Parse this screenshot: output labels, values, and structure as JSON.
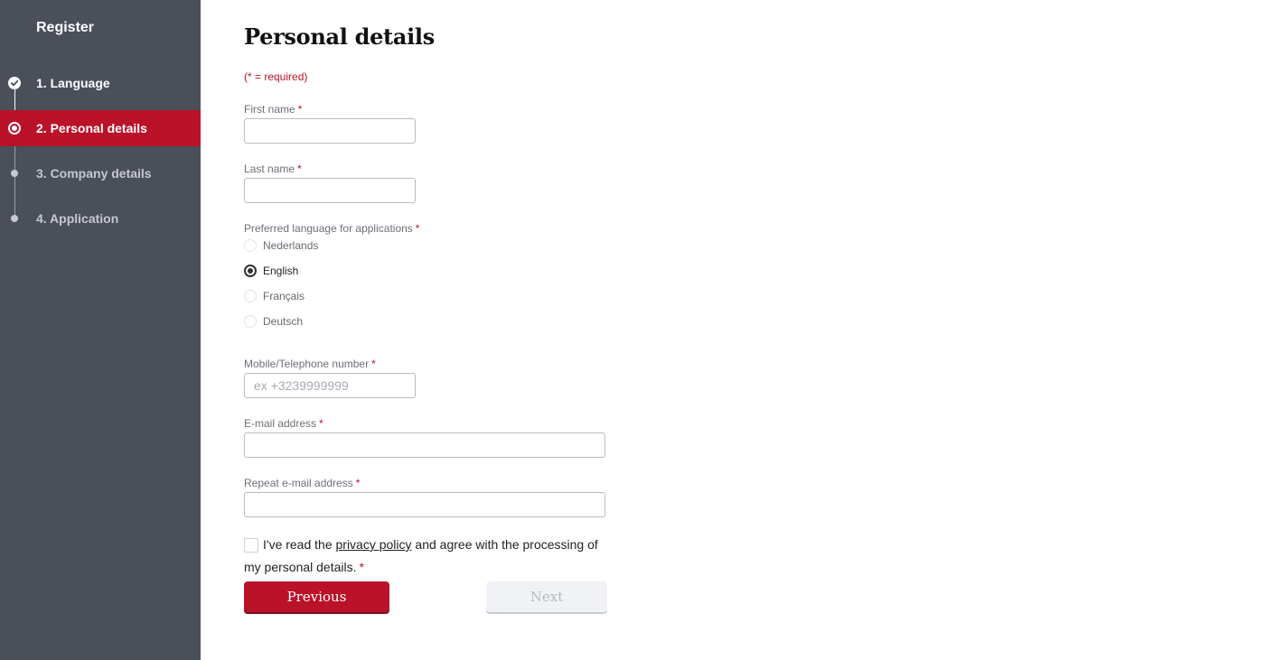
{
  "sidebar": {
    "title": "Register",
    "steps": [
      {
        "label": "1. Language",
        "state": "done",
        "icon": "check-circle-icon"
      },
      {
        "label": "2. Personal details",
        "state": "current",
        "icon": "current-step-icon"
      },
      {
        "label": "3. Company details",
        "state": "pending",
        "icon": "pending-dot-icon"
      },
      {
        "label": "4. Application",
        "state": "pending",
        "icon": "pending-dot-icon"
      }
    ]
  },
  "page": {
    "title": "Personal details",
    "required_note": "(* = required)",
    "required_marker": "*"
  },
  "form": {
    "first_name": {
      "label": "First name",
      "value": "",
      "placeholder": ""
    },
    "last_name": {
      "label": "Last name",
      "value": "",
      "placeholder": ""
    },
    "language": {
      "label": "Preferred language for applications",
      "options": [
        "Nederlands",
        "English",
        "Français",
        "Deutsch"
      ],
      "selected": "English"
    },
    "phone": {
      "label": "Mobile/Telephone number",
      "value": "",
      "placeholder": "ex +3239999999"
    },
    "email": {
      "label": "E-mail address",
      "value": "",
      "placeholder": ""
    },
    "email_repeat": {
      "label": "Repeat e-mail address",
      "value": "",
      "placeholder": ""
    },
    "consent": {
      "text_before": "I've read the ",
      "link": "privacy policy",
      "text_after": " and agree with the processing of my personal details.",
      "checked": false
    }
  },
  "buttons": {
    "previous": "Previous",
    "next": "Next",
    "next_disabled": true
  },
  "colors": {
    "accent": "#ba1229",
    "sidebar_bg": "#4a4f59"
  }
}
